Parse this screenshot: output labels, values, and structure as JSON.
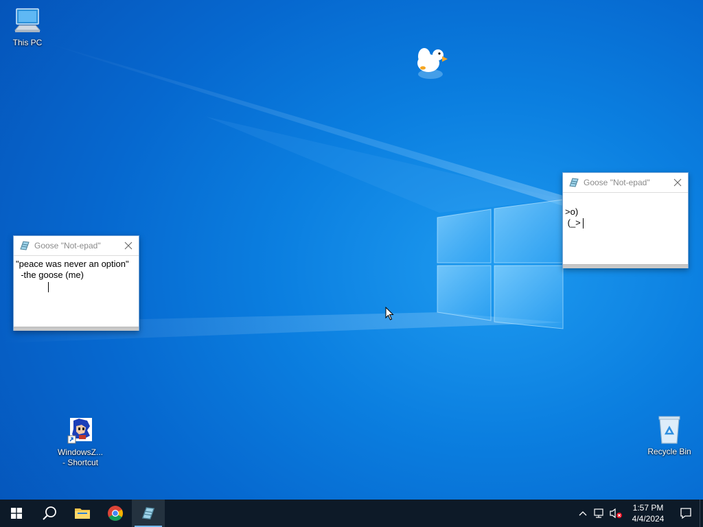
{
  "desktop": {
    "icons": [
      {
        "label": "This PC",
        "icon": "this-pc-icon"
      },
      {
        "label": "WindowsZ...\n- Shortcut",
        "icon": "shortcut-character-icon"
      },
      {
        "label": "Recycle Bin",
        "icon": "recycle-bin-icon"
      }
    ]
  },
  "windows": [
    {
      "title": "Goose \"Not-epad\"",
      "lines": [
        "\"peace was never an option\"",
        "  -the goose (me)"
      ]
    },
    {
      "title": "Goose \"Not-epad\"",
      "lines": [
        ">o)",
        " (_>"
      ]
    }
  ],
  "taskbar": {
    "apps": [
      "start-icon",
      "search-icon",
      "file-explorer-icon",
      "chrome-icon",
      "notepad-icon"
    ],
    "tray": {
      "time": "1:57 PM",
      "date": "4/4/2024"
    }
  },
  "colors": {
    "taskbar": "#0d1a28",
    "desktop_accent": "#0b7fe0"
  }
}
